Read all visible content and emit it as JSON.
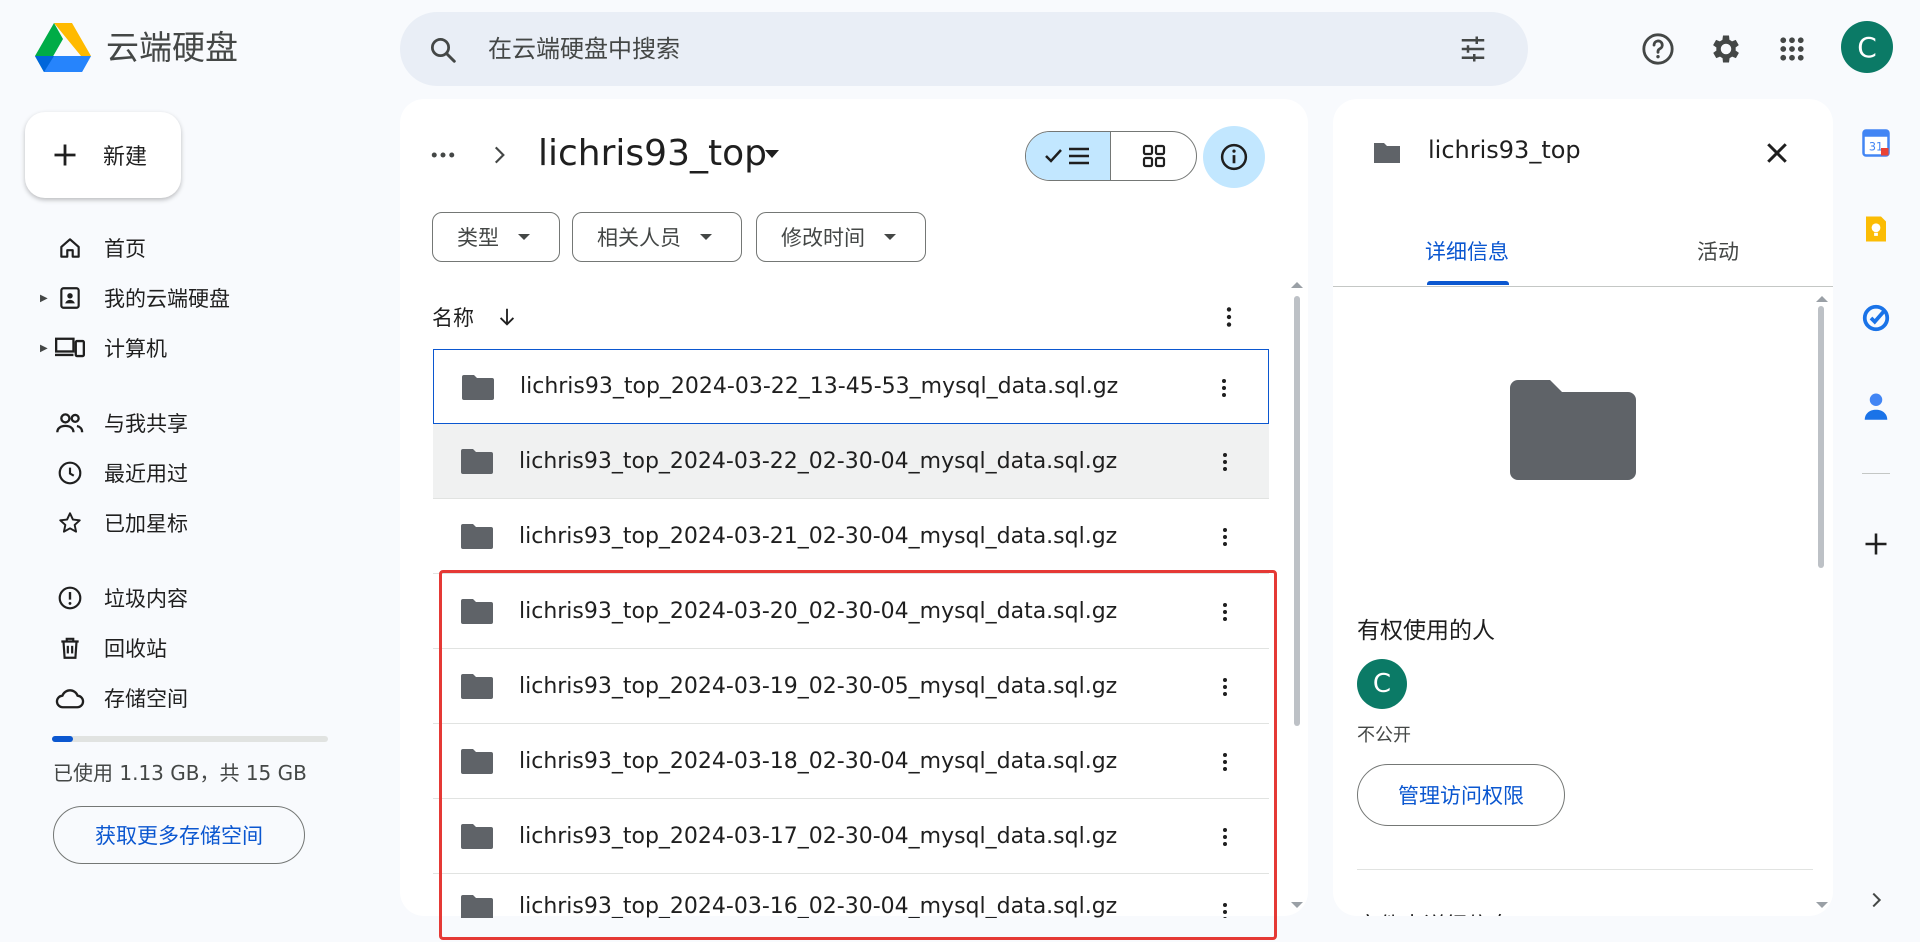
{
  "header": {
    "app_title": "云端硬盘",
    "search_placeholder": "在云端硬盘中搜索",
    "avatar_initial": "C"
  },
  "sidebar": {
    "new_label": "新建",
    "items": [
      {
        "label": "首页",
        "icon": "home-icon"
      },
      {
        "label": "我的云端硬盘",
        "icon": "my-drive-icon"
      },
      {
        "label": "计算机",
        "icon": "computers-icon"
      },
      {
        "label": "与我共享",
        "icon": "shared-icon"
      },
      {
        "label": "最近用过",
        "icon": "recent-icon"
      },
      {
        "label": "已加星标",
        "icon": "star-icon"
      },
      {
        "label": "垃圾内容",
        "icon": "spam-icon"
      },
      {
        "label": "回收站",
        "icon": "trash-icon"
      },
      {
        "label": "存储空间",
        "icon": "cloud-icon"
      }
    ],
    "storage_used_fraction": 0.075,
    "storage_text": "已使用 1.13 GB，共 15 GB",
    "get_storage_label": "获取更多存储空间"
  },
  "main": {
    "folder_title": "lichris93_top",
    "filters": [
      "类型",
      "相关人员",
      "修改时间"
    ],
    "column_name": "名称",
    "files": [
      "lichris93_top_2024-03-22_13-45-53_mysql_data.sql.gz",
      "lichris93_top_2024-03-22_02-30-04_mysql_data.sql.gz",
      "lichris93_top_2024-03-21_02-30-04_mysql_data.sql.gz",
      "lichris93_top_2024-03-20_02-30-04_mysql_data.sql.gz",
      "lichris93_top_2024-03-19_02-30-05_mysql_data.sql.gz",
      "lichris93_top_2024-03-18_02-30-04_mysql_data.sql.gz",
      "lichris93_top_2024-03-17_02-30-04_mysql_data.sql.gz",
      "lichris93_top_2024-03-16_02-30-04_mysql_data.sql.gz"
    ]
  },
  "details": {
    "title": "lichris93_top",
    "tabs": [
      "详细信息",
      "活动"
    ],
    "access_title": "有权使用的人",
    "avatar_initial": "C",
    "visibility": "不公开",
    "manage_label": "管理访问权限",
    "section_more": "文件夹详细信息"
  },
  "colors": {
    "accent": "#0b57d0",
    "avatar": "#0b7a66",
    "highlight": "#e53935",
    "selected_view": "#c2e7ff"
  }
}
